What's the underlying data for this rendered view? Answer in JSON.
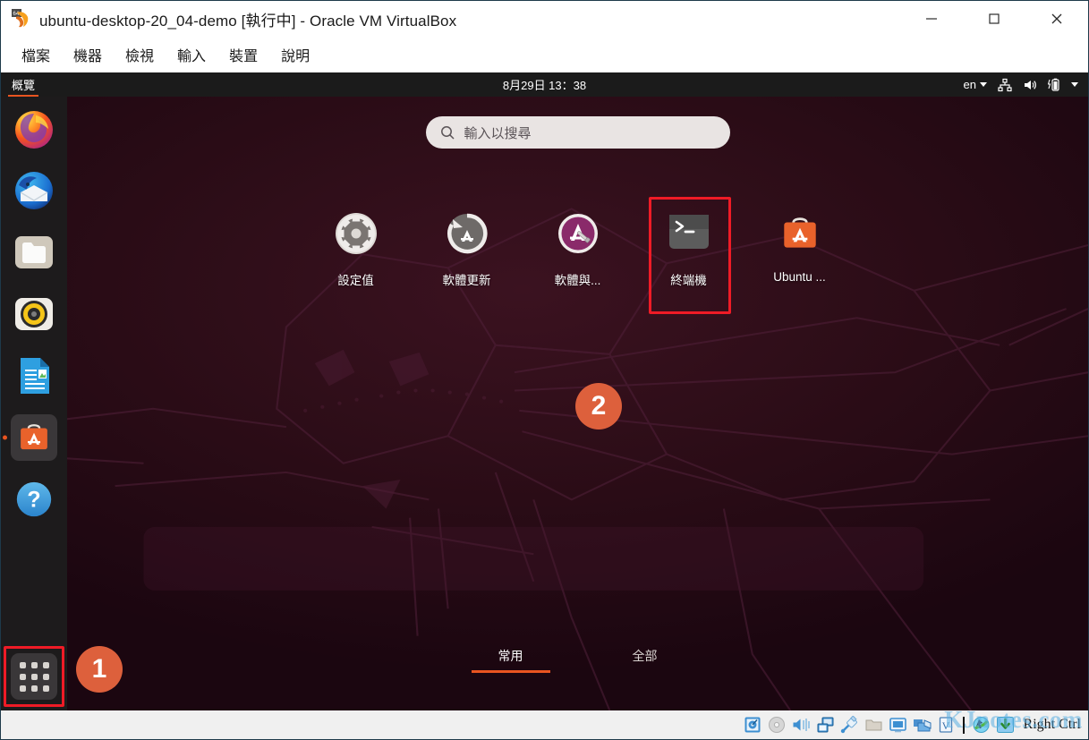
{
  "host_window": {
    "app_icon": "virtualbox-icon",
    "title": "ubuntu-desktop-20_04-demo [執行中] - Oracle VM VirtualBox",
    "menu": [
      {
        "label": "檔案",
        "name": "menu-file"
      },
      {
        "label": "機器",
        "name": "menu-machine"
      },
      {
        "label": "檢視",
        "name": "menu-view"
      },
      {
        "label": "輸入",
        "name": "menu-input"
      },
      {
        "label": "裝置",
        "name": "menu-devices"
      },
      {
        "label": "說明",
        "name": "menu-help"
      }
    ],
    "window_buttons": {
      "minimize": "─",
      "maximize": "□",
      "close": "✕"
    }
  },
  "guest": {
    "topbar": {
      "activities_label": "概覽",
      "clock": "8月29日  13：38",
      "keyboard_layout": "en",
      "indicators": [
        "network-icon",
        "volume-icon",
        "battery-icon",
        "chevron-down-icon"
      ]
    },
    "dock": {
      "items": [
        {
          "name": "dock-item-firefox",
          "label": "Firefox",
          "icon": "firefox-icon",
          "running": false
        },
        {
          "name": "dock-item-thunderbird",
          "label": "Thunderbird Mail",
          "icon": "thunderbird-icon",
          "running": false
        },
        {
          "name": "dock-item-files",
          "label": "Files",
          "icon": "files-folder-icon",
          "running": false
        },
        {
          "name": "dock-item-rhythmbox",
          "label": "Rhythmbox",
          "icon": "rhythmbox-icon",
          "running": false
        },
        {
          "name": "dock-item-libreoffice-writer",
          "label": "LibreOffice Writer",
          "icon": "libreoffice-writer-icon",
          "running": false
        },
        {
          "name": "dock-item-ubuntu-software",
          "label": "Ubuntu Software",
          "icon": "ubuntu-software-icon",
          "running": true
        },
        {
          "name": "dock-item-help",
          "label": "Help",
          "icon": "help-question-icon",
          "running": false
        }
      ],
      "show_apps": {
        "name": "show-applications-button",
        "icon": "app-grid-icon",
        "highlighted": true
      }
    },
    "overview": {
      "search": {
        "placeholder": "輸入以搜尋",
        "value": "",
        "icon": "search-icon"
      },
      "apps": [
        {
          "label": "設定值",
          "icon": "settings-gear-icon",
          "name": "app-settings",
          "highlighted": false
        },
        {
          "label": "軟體更新",
          "icon": "software-updater-icon",
          "name": "app-software-updater",
          "highlighted": false
        },
        {
          "label": "軟體與...",
          "icon": "software-and-updates-icon",
          "name": "app-software-and-updates",
          "highlighted": false
        },
        {
          "label": "終端機",
          "icon": "terminal-icon",
          "name": "app-terminal",
          "highlighted": true
        },
        {
          "label": "Ubuntu ...",
          "icon": "ubuntu-software-icon",
          "name": "app-ubuntu-software",
          "highlighted": false
        }
      ],
      "view_tabs": [
        {
          "label": "常用",
          "name": "tab-frequent",
          "active": true
        },
        {
          "label": "全部",
          "name": "tab-all",
          "active": false
        }
      ]
    }
  },
  "annotations": {
    "badges": [
      {
        "number": "1",
        "name": "step-badge-1"
      },
      {
        "number": "2",
        "name": "step-badge-2"
      }
    ],
    "highlight_color": "#ef1b26",
    "badge_color": "#dd603c"
  },
  "statusbar": {
    "icons": [
      "hard-disk-icon",
      "optical-disk-icon",
      "audio-icon",
      "network-adapter-icon",
      "usb-icon",
      "shared-folder-icon",
      "display-icon",
      "recording-icon",
      "vm-session-icon"
    ],
    "mouse_icon": "mouse-integration-icon",
    "keyboard_icon": "keyboard-capture-icon",
    "host_key_label": "Right Ctrl"
  },
  "watermark": {
    "text": "KJnotes.com"
  }
}
